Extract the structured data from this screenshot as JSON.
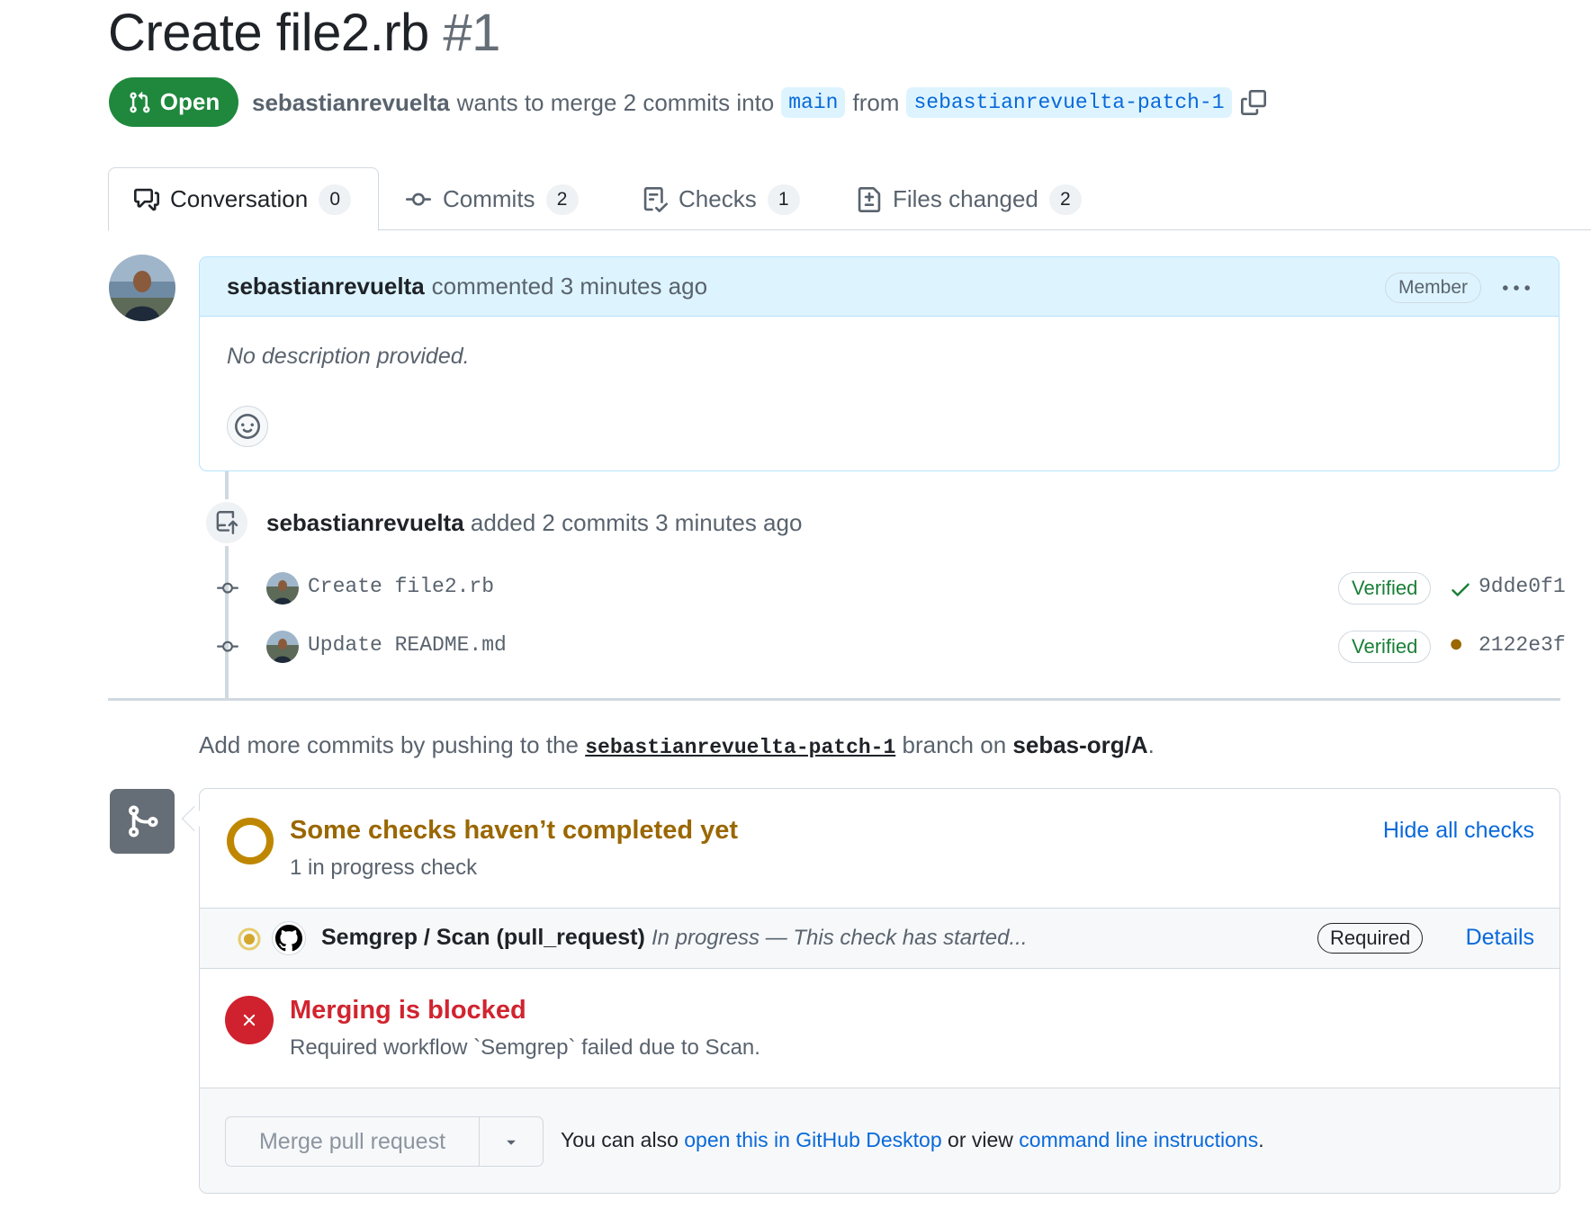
{
  "pr": {
    "title": "Create file2.rb",
    "number": "#1",
    "state": "Open",
    "author": "sebastianrevuelta",
    "merge_text": "wants to merge 2 commits into",
    "base_branch": "main",
    "from_text": "from",
    "head_branch": "sebastianrevuelta-patch-1"
  },
  "tabs": [
    {
      "label": "Conversation",
      "count": "0",
      "icon": "comment-discussion-icon"
    },
    {
      "label": "Commits",
      "count": "2",
      "icon": "git-commit-icon"
    },
    {
      "label": "Checks",
      "count": "1",
      "icon": "checklist-icon"
    },
    {
      "label": "Files changed",
      "count": "2",
      "icon": "file-diff-icon"
    }
  ],
  "comment": {
    "author": "sebastianrevuelta",
    "action": "commented 3 minutes ago",
    "badge": "Member",
    "body": "No description provided."
  },
  "push_event": {
    "author": "sebastianrevuelta",
    "text": "added 2 commits 3 minutes ago"
  },
  "commits": [
    {
      "message": "Create file2.rb",
      "verified": "Verified",
      "status": "success",
      "sha": "9dde0f1"
    },
    {
      "message": "Update README.md",
      "verified": "Verified",
      "status": "pending",
      "sha": "2122e3f"
    }
  ],
  "push_hint": {
    "prefix": "Add more commits by pushing to the",
    "branch": "sebastianrevuelta-patch-1",
    "middle": "branch on",
    "repo": "sebas-org/A",
    "suffix": "."
  },
  "checks": {
    "title": "Some checks haven’t completed yet",
    "subtitle": "1 in progress check",
    "toggle": "Hide all checks",
    "items": [
      {
        "name": "Semgrep / Scan (pull_request)",
        "status": "In progress — This check has started...",
        "badge": "Required",
        "link": "Details"
      }
    ]
  },
  "merge": {
    "blocked_title": "Merging is blocked",
    "blocked_reason": "Required workflow `Semgrep` failed due to Scan.",
    "button": "Merge pull request",
    "alt_prefix": "You can also",
    "alt_link1": "open this in GitHub Desktop",
    "alt_middle": "or view",
    "alt_link2": "command line instructions",
    "alt_suffix": "."
  },
  "colors": {
    "open_green": "#1f883d",
    "link_blue": "#0969da",
    "pending_amber": "#9a6700",
    "blocked_red": "#cf222e",
    "verified_green": "#1a7f37"
  }
}
